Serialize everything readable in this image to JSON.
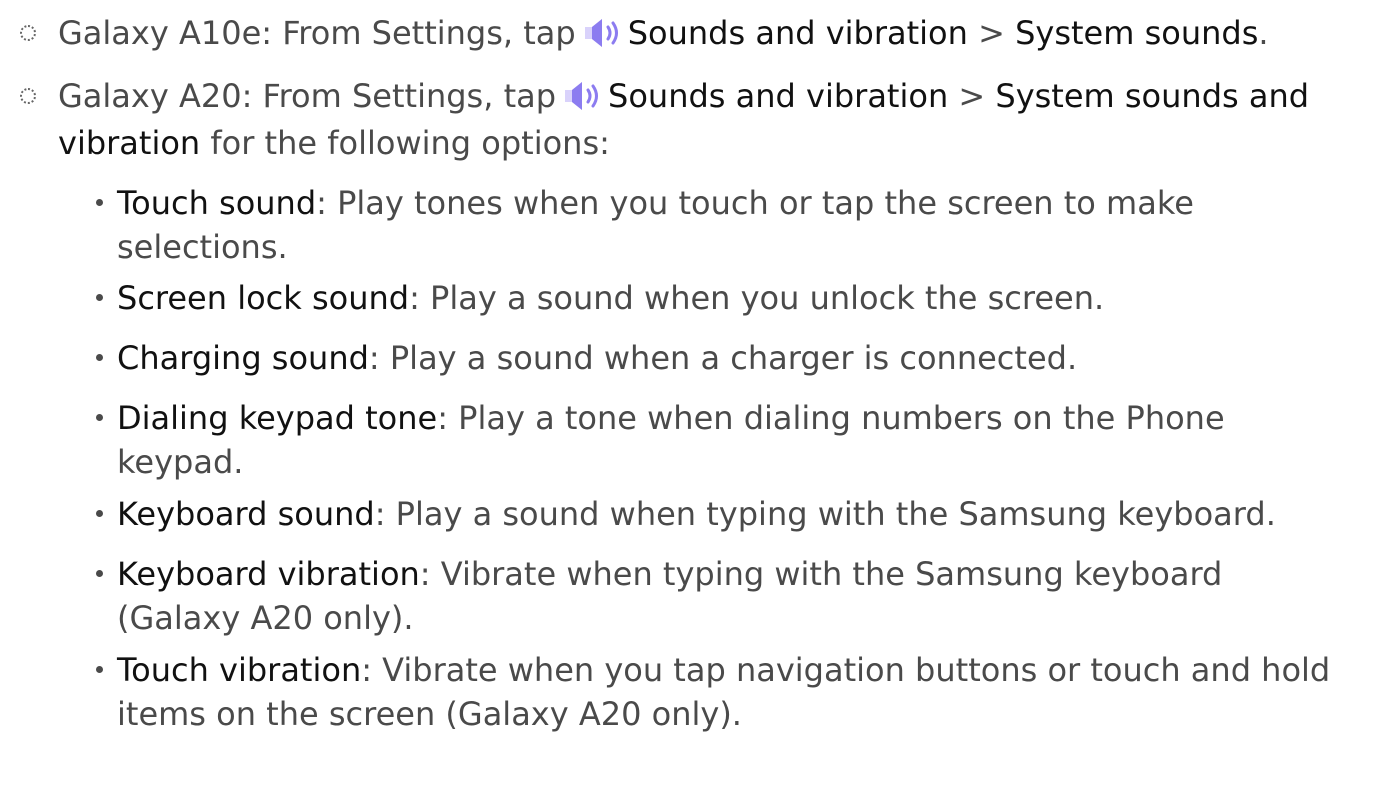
{
  "items": [
    {
      "prefix": "Galaxy A10e: From Settings, tap",
      "icon": "speaker-volume-icon",
      "link1": "Sounds and vibration",
      "sep": " > ",
      "link2": "System sounds",
      "end": "."
    },
    {
      "prefix": "Galaxy A20: From Settings, tap",
      "icon": "speaker-volume-icon",
      "link1": "Sounds and vibration",
      "sep": " > ",
      "link2a": "System sounds and",
      "link2b": "vibration",
      "end": " for the following options:"
    }
  ],
  "options": [
    {
      "term": "Touch sound",
      "line1": ": Play tones when you touch or tap the screen to make",
      "line2": "selections."
    },
    {
      "term": "Screen lock sound",
      "line1": ": Play a sound when you unlock the screen."
    },
    {
      "term": "Charging sound",
      "line1": ": Play a sound when a charger is connected."
    },
    {
      "term": "Dialing keypad tone",
      "line1": ": Play a tone when dialing numbers on the Phone",
      "line2": "keypad."
    },
    {
      "term": "Keyboard sound",
      "line1": ": Play a sound when typing with the Samsung keyboard."
    },
    {
      "term": "Keyboard vibration",
      "line1": ": Vibrate when typing with the Samsung keyboard",
      "line2": "(Galaxy A20 only)."
    },
    {
      "term": "Touch vibration",
      "line1": ": Vibrate when you tap navigation buttons or touch and hold",
      "line2": "items on the screen (Galaxy A20 only)."
    }
  ],
  "colors": {
    "text": "#4a4a4a",
    "bold": "#111111",
    "icon": "#8c7cf0"
  }
}
